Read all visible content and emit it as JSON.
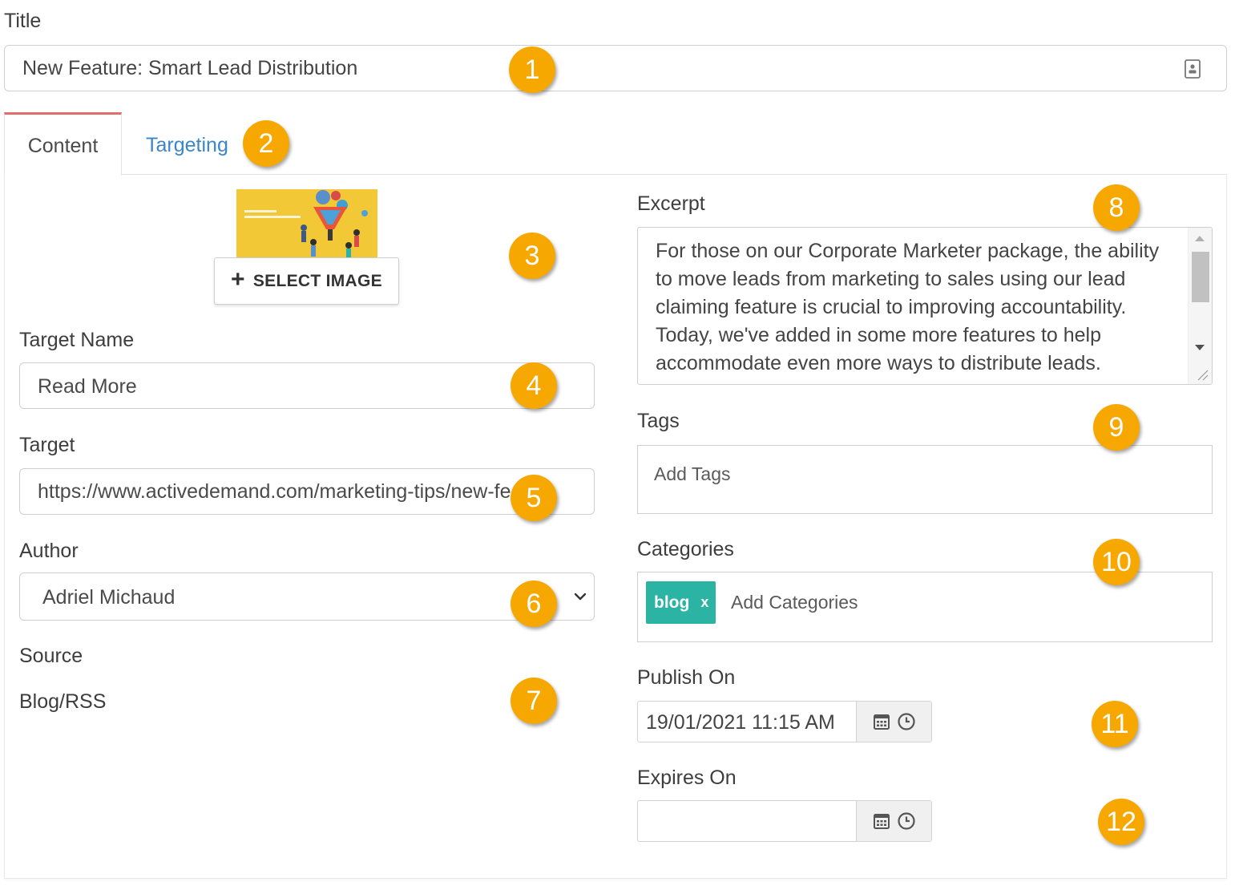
{
  "title": {
    "label": "Title",
    "value": "New Feature: Smart Lead Distribution"
  },
  "tabs": [
    {
      "label": "Content",
      "active": true
    },
    {
      "label": "Targeting",
      "active": false
    }
  ],
  "image": {
    "button_label": "SELECT IMAGE",
    "thumbnail_caption": "New Feature: Smart Lead Distribution"
  },
  "target_name": {
    "label": "Target Name",
    "value": "Read More"
  },
  "target": {
    "label": "Target",
    "value": "https://www.activedemand.com/marketing-tips/new-featur"
  },
  "author": {
    "label": "Author",
    "value": "Adriel Michaud"
  },
  "source": {
    "label": "Source",
    "value": "Blog/RSS"
  },
  "excerpt": {
    "label": "Excerpt",
    "value": "For those on our Corporate Marketer package, the ability to move leads from marketing to sales using our lead claiming feature is crucial to improving accountability. Today, we've added in some more features to help accommodate even more ways to distribute leads."
  },
  "tags": {
    "label": "Tags",
    "placeholder": "Add Tags"
  },
  "categories": {
    "label": "Categories",
    "placeholder": "Add Categories",
    "items": [
      {
        "label": "blog",
        "remove": "x"
      }
    ]
  },
  "publish_on": {
    "label": "Publish On",
    "value": "19/01/2021 11:15 AM"
  },
  "expires_on": {
    "label": "Expires On",
    "value": ""
  },
  "badges": [
    "1",
    "2",
    "3",
    "4",
    "5",
    "6",
    "7",
    "8",
    "9",
    "10",
    "11",
    "12"
  ],
  "colors": {
    "accent_tab": "#e26d6d",
    "link": "#3a86c8",
    "chip": "#2bb3a3",
    "badge": "#f6a800"
  }
}
